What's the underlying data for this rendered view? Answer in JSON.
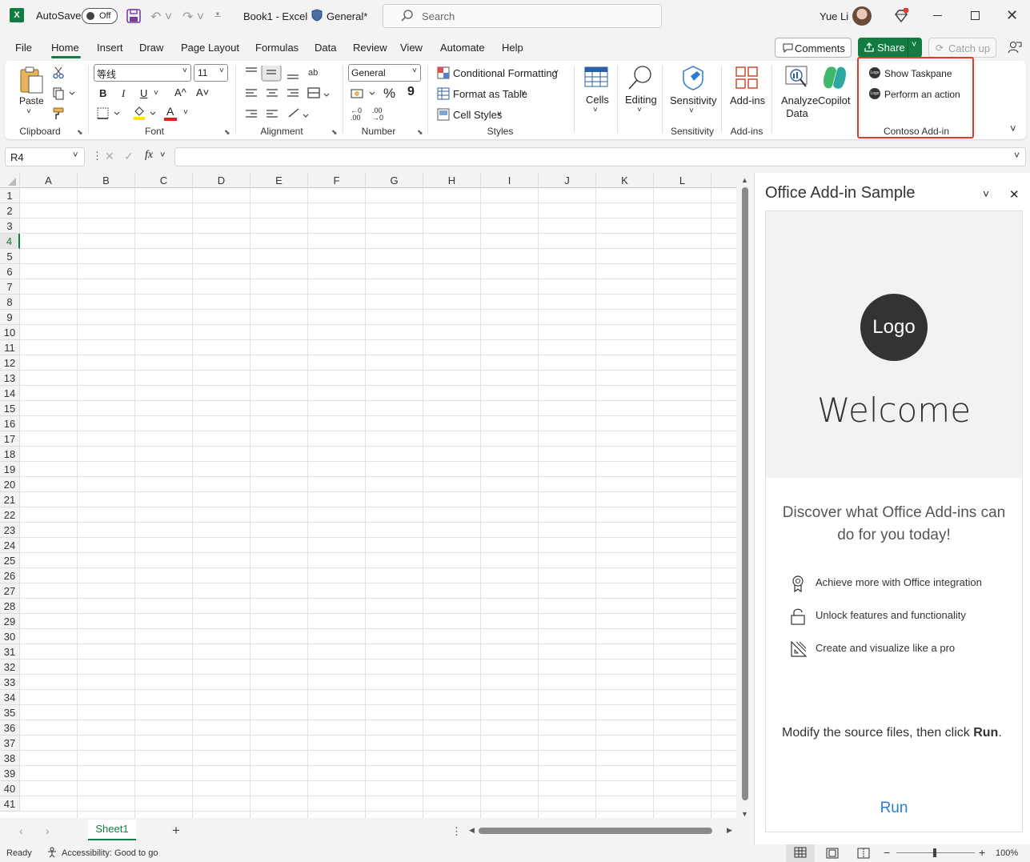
{
  "titlebar": {
    "app_icon": "X",
    "autosave_label": "AutoSave",
    "autosave_state": "Off",
    "doc_title": "Book1  -  Excel",
    "sensitivity": "General*",
    "search_placeholder": "Search",
    "user_name": "Yue Li"
  },
  "menu": {
    "items": [
      "File",
      "Home",
      "Insert",
      "Draw",
      "Page Layout",
      "Formulas",
      "Data",
      "Review",
      "View",
      "Automate",
      "Help"
    ],
    "active": "Home",
    "comments": "Comments",
    "share": "Share",
    "catch_up": "Catch up"
  },
  "ribbon": {
    "clipboard": {
      "paste": "Paste",
      "label": "Clipboard"
    },
    "font": {
      "name": "等线",
      "size": "11",
      "label": "Font",
      "bold": "B",
      "italic": "I",
      "underline": "U",
      "grow": "A^",
      "shrink": "A˅",
      "color_letter": "A"
    },
    "alignment": {
      "label": "Alignment"
    },
    "number": {
      "format": "General",
      "label": "Number",
      "percent": "%",
      "comma": "9"
    },
    "styles": {
      "conditional": "Conditional Formatting",
      "table": "Format as Table",
      "cell": "Cell Styles",
      "label": "Styles"
    },
    "cells": {
      "label": "Cells"
    },
    "editing": {
      "label": "Editing"
    },
    "sensitivity": {
      "button": "Sensitivity",
      "label": "Sensitivity"
    },
    "addins": {
      "button": "Add-ins",
      "label": "Add-ins"
    },
    "analyze": {
      "line1": "Analyze",
      "line2": "Data"
    },
    "copilot": {
      "button": "Copilot"
    },
    "contoso": {
      "show": "Show Taskpane",
      "perform": "Perform an action",
      "label": "Contoso Add-in",
      "icon_text": "Logo"
    }
  },
  "formula_bar": {
    "name_box": "R4",
    "fx": "fx",
    "value": ""
  },
  "grid": {
    "columns": [
      "A",
      "B",
      "C",
      "D",
      "E",
      "F",
      "G",
      "H",
      "I",
      "J",
      "K",
      "L"
    ],
    "rows": [
      "1",
      "2",
      "3",
      "4",
      "5",
      "6",
      "7",
      "8",
      "9",
      "10",
      "11",
      "12",
      "13",
      "14",
      "15",
      "16",
      "17",
      "18",
      "19",
      "20",
      "21",
      "22",
      "23",
      "24",
      "25",
      "26",
      "27",
      "28",
      "29",
      "30",
      "31",
      "32",
      "33",
      "34",
      "35",
      "36",
      "37",
      "38",
      "39",
      "40",
      "41"
    ],
    "active_row": "4"
  },
  "sheets": {
    "tabs": [
      "Sheet1"
    ],
    "add": "+"
  },
  "status": {
    "ready": "Ready",
    "accessibility": "Accessibility: Good to go",
    "zoom": "100%",
    "minus": "−",
    "plus": "+"
  },
  "pane": {
    "title": "Office Add-in Sample",
    "logo": "Logo",
    "welcome": "Welcome",
    "discover": "Discover what Office Add-ins can do for you today!",
    "features": [
      {
        "icon": "ribbon-icon",
        "text": "Achieve more with Office integration"
      },
      {
        "icon": "unlock-icon",
        "text": "Unlock features and functionality"
      },
      {
        "icon": "design-ideas-icon",
        "text": "Create and visualize like a pro"
      }
    ],
    "modify_text": "Modify the source files, then click ",
    "modify_bold": "Run",
    "modify_end": ".",
    "run": "Run"
  },
  "colors": {
    "accent": "#107c41",
    "highlight": "#e03a2e",
    "link": "#2b7cd3"
  }
}
